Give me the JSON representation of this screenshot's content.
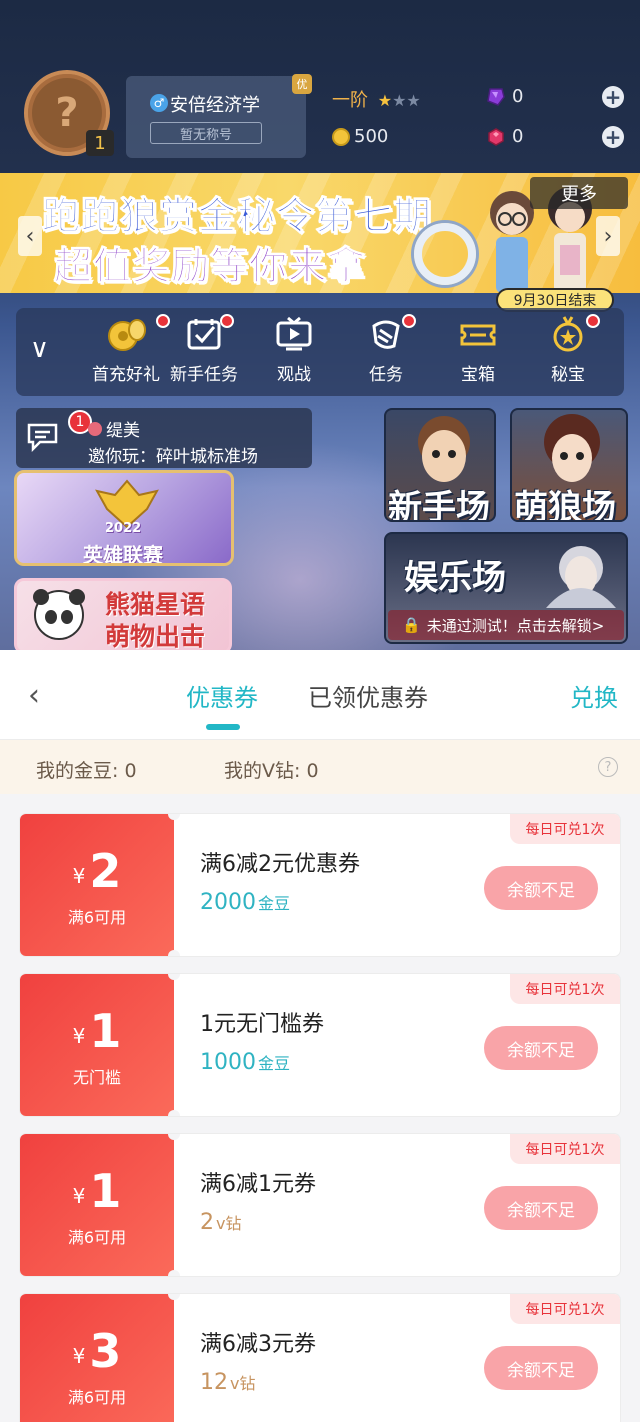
{
  "profile": {
    "username": "安倍经济学",
    "title_tag": "暂无称号",
    "you_badge": "优",
    "level": "1",
    "rank_label": "一阶",
    "rank_stars_filled": 1,
    "rank_stars_total": 3,
    "gold_coins": "500",
    "purple_gems": "0",
    "red_gems": "0"
  },
  "banner": {
    "line1": "跑跑狼赏金秘令第七期",
    "line2": "超值奖励等你来拿",
    "more_label": "更多",
    "prev_arrow": "‹",
    "next_arrow": "›",
    "deadline": "9月30日结束"
  },
  "menu": {
    "items": [
      {
        "label": "首充好礼",
        "icon": "coins-icon",
        "red_dot": true
      },
      {
        "label": "新手任务",
        "icon": "checklist-icon",
        "red_dot": true
      },
      {
        "label": "观战",
        "icon": "tv-icon",
        "red_dot": false
      },
      {
        "label": "任务",
        "icon": "scroll-icon",
        "red_dot": true
      },
      {
        "label": "宝箱",
        "icon": "ticket-icon",
        "red_dot": false
      },
      {
        "label": "秘宝",
        "icon": "medal-icon",
        "red_dot": true
      }
    ]
  },
  "invite": {
    "badge_count": "1",
    "from": "缇美",
    "message": "邀你玩：碎叶城标准场"
  },
  "modes": {
    "newbie": "新手场",
    "cute_wolf": "萌狼场",
    "entertainment": "娱乐场",
    "lock_text": "未通过测试！点击去解锁>"
  },
  "events": {
    "league_title": "英雄联赛",
    "league_year": "2022",
    "panda_line1": "熊猫星语",
    "panda_line2": "萌物出击"
  },
  "coupon_panel": {
    "back_label": "‹",
    "tabs": [
      {
        "label": "优惠券",
        "active": true
      },
      {
        "label": "已领优惠券",
        "active": false
      }
    ],
    "exchange_label": "兑换",
    "balance_gold": "我的金豆: 0",
    "balance_vdiamond": "我的V钻: 0",
    "help_label": "?",
    "coupons": [
      {
        "symbol": "¥",
        "amount": "2",
        "condition": "满6可用",
        "name": "满6减2元优惠券",
        "price": "2000",
        "price_unit": "金豆",
        "currency": "gold",
        "daily_limit": "每日可兑1次",
        "button": "余额不足"
      },
      {
        "symbol": "¥",
        "amount": "1",
        "condition": "无门槛",
        "name": "1元无门槛券",
        "price": "1000",
        "price_unit": "金豆",
        "currency": "gold",
        "daily_limit": "每日可兑1次",
        "button": "余额不足"
      },
      {
        "symbol": "¥",
        "amount": "1",
        "condition": "满6可用",
        "name": "满6减1元券",
        "price": "2",
        "price_unit": "v钻",
        "currency": "vdia",
        "daily_limit": "每日可兑1次",
        "button": "余额不足"
      },
      {
        "symbol": "¥",
        "amount": "3",
        "condition": "满6可用",
        "name": "满6减3元券",
        "price": "12",
        "price_unit": "v钻",
        "currency": "vdia",
        "daily_limit": "每日可兑1次",
        "button": "余额不足"
      }
    ]
  },
  "colors": {
    "accent": "#22b7c6",
    "coupon_red": "#f0413f",
    "disabled_button": "#f9a4a8",
    "gold_price": "#2fb3c2",
    "vdia_price": "#c79460"
  }
}
